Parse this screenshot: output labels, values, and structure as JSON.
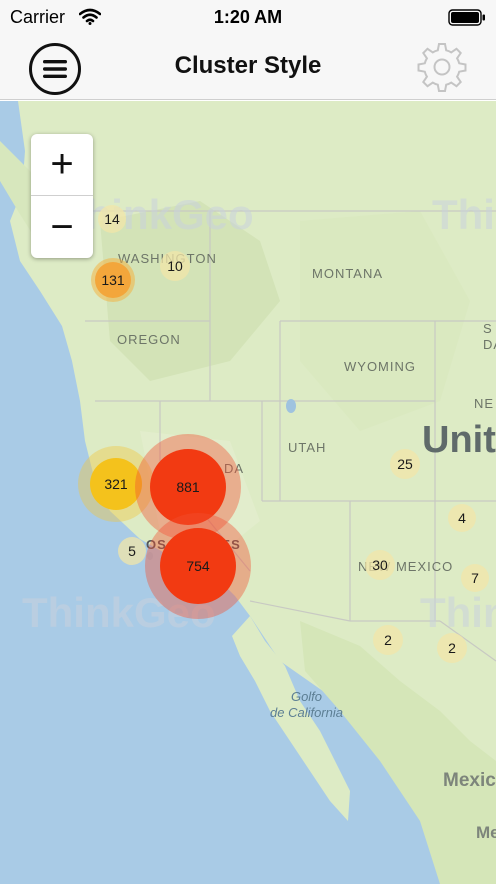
{
  "status_bar": {
    "carrier": "Carrier",
    "time": "1:20 AM"
  },
  "nav": {
    "title": "Cluster Style",
    "menu_icon": "menu-icon",
    "settings_icon": "gear-icon"
  },
  "zoom": {
    "in_label": "+",
    "out_label": "−"
  },
  "map": {
    "labels": {
      "washington": "WASHINGTON",
      "montana": "MONTANA",
      "oregon": "OREGON",
      "wyoming": "WYOMING",
      "utah": "UTAH",
      "nevada_fragment": "DA",
      "new_mexico": "NEW MEXICO",
      "los_angeles_fragment": "OS ANGELES",
      "united": "Unit",
      "sd_fragment": "S\nDA",
      "ne_fragment": "NE",
      "gulf": "Golfo\nde California",
      "mexico": "Mexic",
      "me_fragment": "Me"
    },
    "watermarks": [
      "ThinkGeo",
      "ThinkGeo",
      "ThinkGeo",
      "ThinkGeo"
    ],
    "clusters": [
      {
        "count": "14",
        "tier": "small"
      },
      {
        "count": "10",
        "tier": "small"
      },
      {
        "count": "131",
        "tier": "medium"
      },
      {
        "count": "321",
        "tier": "medium-large"
      },
      {
        "count": "881",
        "tier": "large"
      },
      {
        "count": "754",
        "tier": "large"
      },
      {
        "count": "5",
        "tier": "small"
      },
      {
        "count": "25",
        "tier": "small"
      },
      {
        "count": "4",
        "tier": "small"
      },
      {
        "count": "30",
        "tier": "small"
      },
      {
        "count": "7",
        "tier": "small"
      },
      {
        "count": "2",
        "tier": "small"
      },
      {
        "count": "2",
        "tier": "small"
      }
    ],
    "colors": {
      "water": "#a9cbe6",
      "land": "#ddebc5",
      "small_cluster": "#f2e6a8",
      "medium_cluster": "#f3a63b",
      "large_cluster": "#f23a12"
    }
  }
}
